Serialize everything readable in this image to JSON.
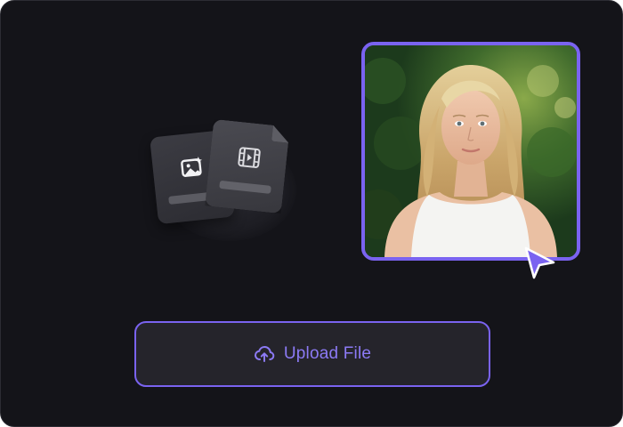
{
  "upload_button": {
    "label": "Upload File",
    "icon": "cloud-upload-icon"
  },
  "file_cards": [
    {
      "icon": "image-sparkle-icon"
    },
    {
      "icon": "video-file-icon"
    }
  ],
  "photo": {
    "subject": "portrait-photo"
  },
  "colors": {
    "background": "#141419",
    "accent": "#7a63f0",
    "accent_text": "#8c7af5",
    "button_fill": "#25242b"
  }
}
